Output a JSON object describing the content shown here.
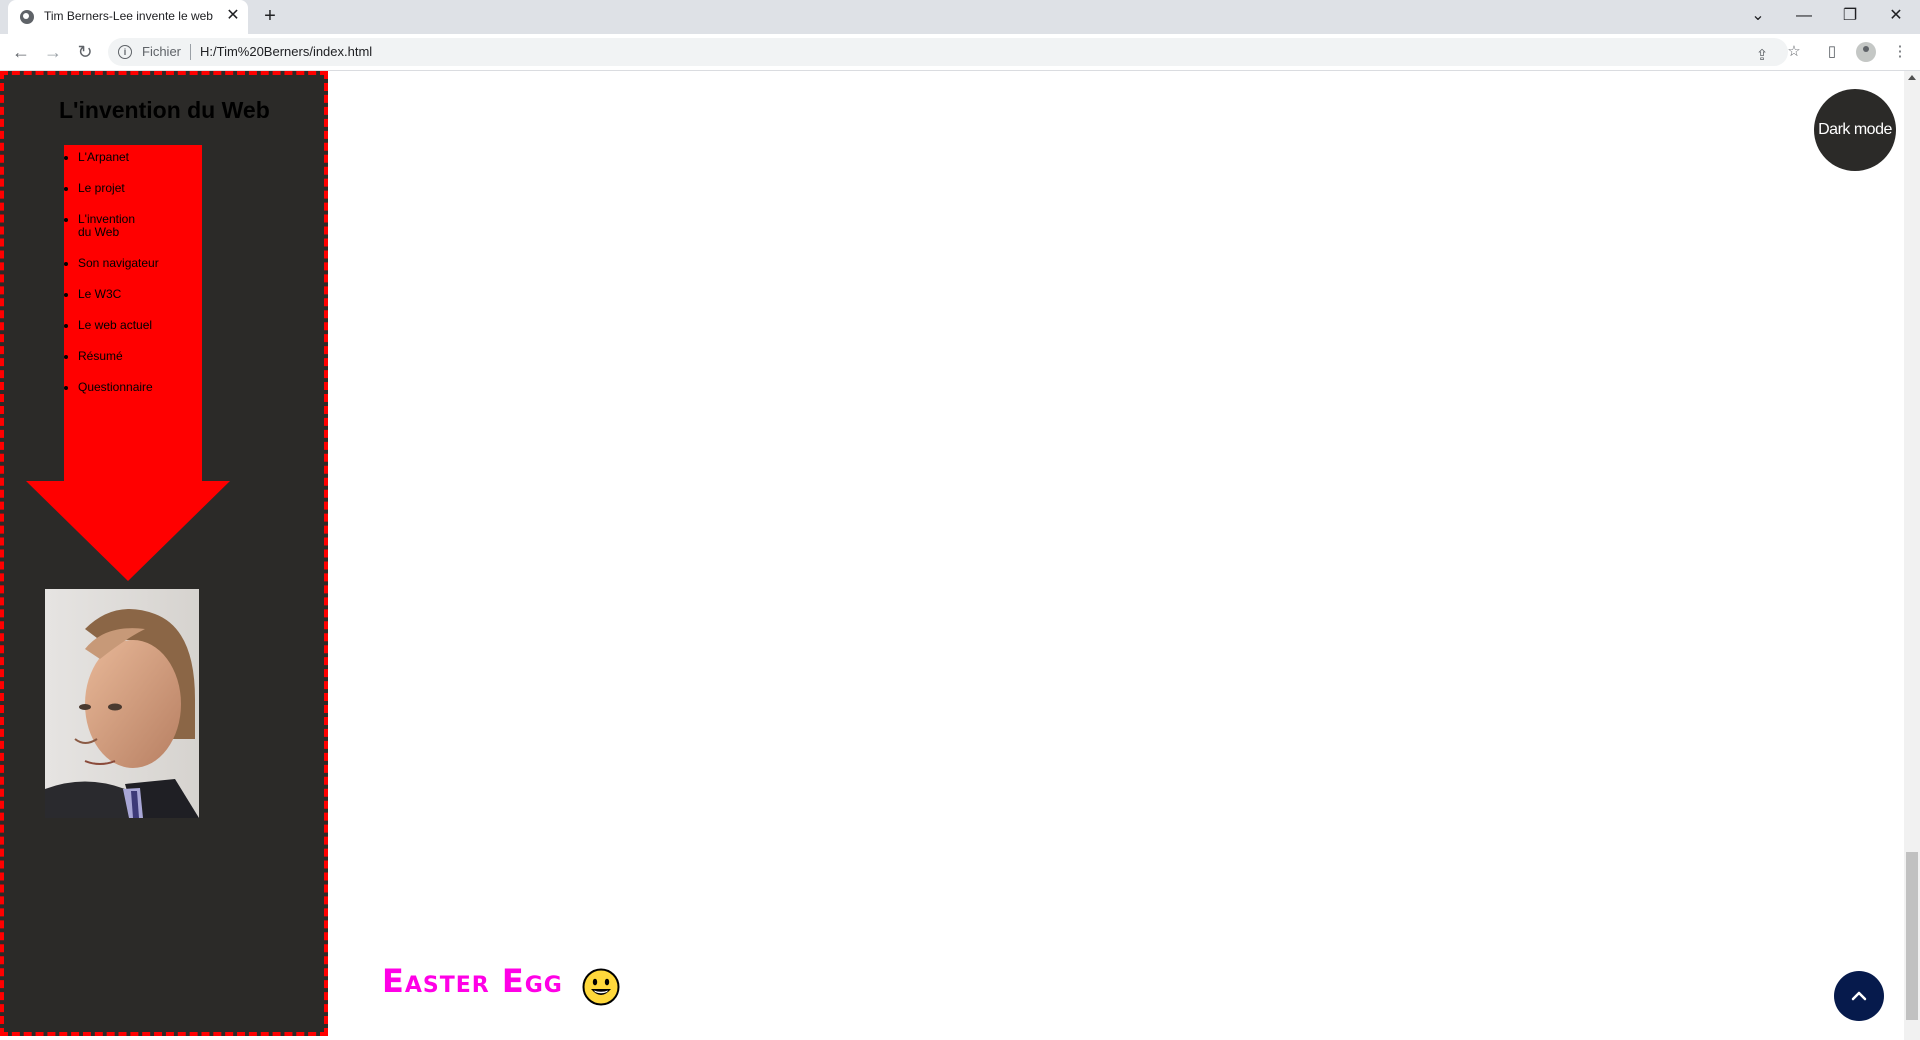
{
  "browser": {
    "tab_title": "Tim Berners-Lee invente le web",
    "tab_close": "✕",
    "new_tab": "+",
    "url_scheme": "Fichier",
    "url": "H:/Tim%20Berners/index.html",
    "window_controls": {
      "tabsearch": "⌄",
      "minimize": "—",
      "restore": "❐",
      "close": "✕"
    },
    "nav": {
      "back": "←",
      "forward": "→",
      "reload": "↻"
    },
    "toolbar_icons": {
      "share": "⇪",
      "bookmark": "☆",
      "sidepanel": "▯",
      "menu": "⋮"
    }
  },
  "sidebar": {
    "title": "L'invention du Web",
    "nav_items": [
      {
        "label": "L'Arpanet"
      },
      {
        "label": "Le projet"
      },
      {
        "label": "L'invention du Web"
      },
      {
        "label": "Son navigateur"
      },
      {
        "label": "Le W3C"
      },
      {
        "label": "Le web actuel"
      },
      {
        "label": "Résumé"
      },
      {
        "label": "Questionnaire"
      }
    ],
    "arrow_color": "#ff0000",
    "border_color": "#ff0000",
    "background": "#2b2a28"
  },
  "main": {
    "dark_mode_label": "Dark mode",
    "easter_egg": "Easter Egg",
    "easter_egg_color": "#ff00e6",
    "back_to_top_icon": "chevron-up-icon"
  }
}
